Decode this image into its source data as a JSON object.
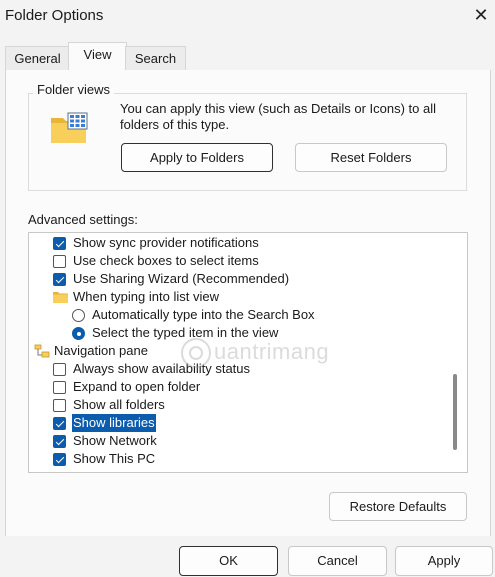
{
  "window": {
    "title": "Folder Options"
  },
  "tabs": [
    {
      "label": "General"
    },
    {
      "label": "View"
    },
    {
      "label": "Search"
    }
  ],
  "folder_views": {
    "label": "Folder views",
    "description": "You can apply this view (such as Details or Icons) to all folders of this type.",
    "apply_label": "Apply to Folders",
    "reset_label": "Reset Folders"
  },
  "advanced": {
    "label": "Advanced settings:",
    "items": [
      {
        "text": "Show sync provider notifications",
        "control": "checkbox",
        "checked": true
      },
      {
        "text": "Use check boxes to select items",
        "control": "checkbox",
        "checked": false
      },
      {
        "text": "Use Sharing Wizard (Recommended)",
        "control": "checkbox",
        "checked": true
      },
      {
        "text": "When typing into list view",
        "control": "folder"
      },
      {
        "text": "Automatically type into the Search Box",
        "control": "radio",
        "checked": false
      },
      {
        "text": "Select the typed item in the view",
        "control": "radio",
        "checked": true
      },
      {
        "text": "Navigation pane",
        "control": "tree"
      },
      {
        "text": "Always show availability status",
        "control": "checkbox",
        "checked": false
      },
      {
        "text": "Expand to open folder",
        "control": "checkbox",
        "checked": false
      },
      {
        "text": "Show all folders",
        "control": "checkbox",
        "checked": false
      },
      {
        "text": "Show libraries",
        "control": "checkbox",
        "checked": true,
        "selected": true
      },
      {
        "text": "Show Network",
        "control": "checkbox",
        "checked": true
      },
      {
        "text": "Show This PC",
        "control": "checkbox",
        "checked": true
      }
    ]
  },
  "restore_label": "Restore Defaults",
  "footer": {
    "ok_label": "OK",
    "cancel_label": "Cancel",
    "apply_label": "Apply"
  },
  "watermark": "uantrimang",
  "colors": {
    "accent": "#0b5cad",
    "folder": "#f5c242"
  }
}
